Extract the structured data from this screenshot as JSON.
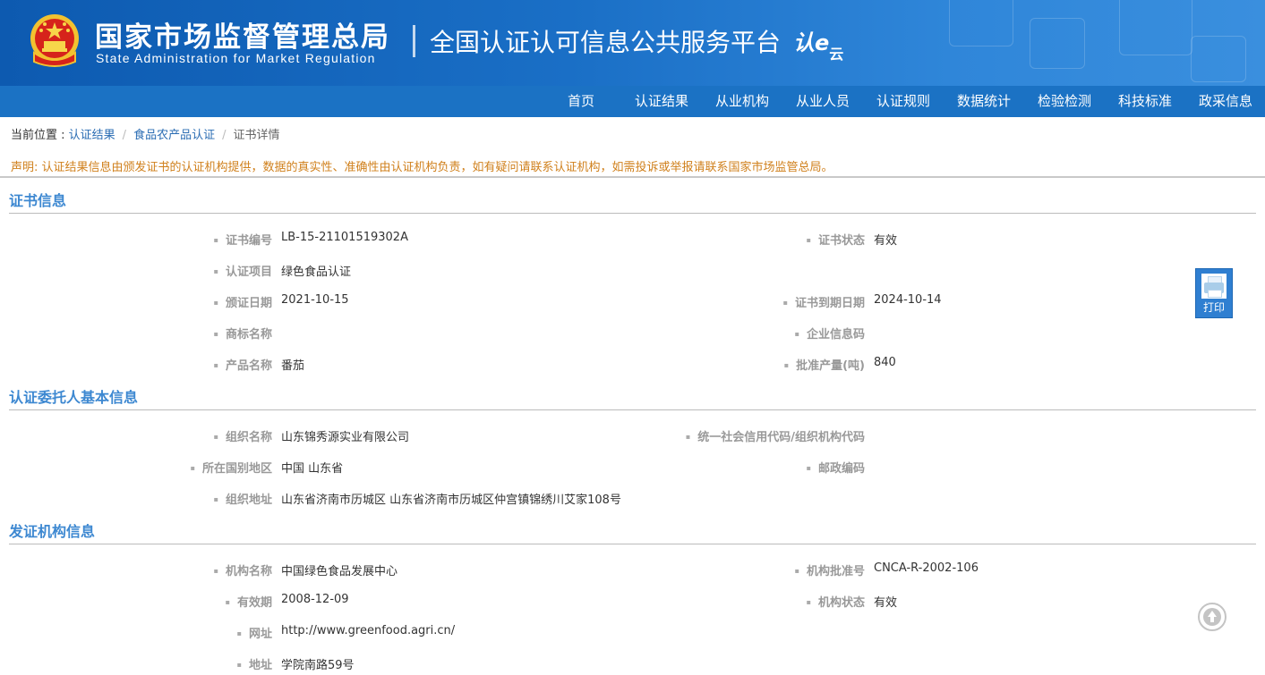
{
  "header": {
    "title_cn": "国家市场监督管理总局",
    "title_en": "State Administration  for  Market Regulation",
    "platform": "全国认证认可信息公共服务平台",
    "logo_text": "认e",
    "logo_sub": "云"
  },
  "nav": {
    "items": [
      {
        "label": "首页"
      },
      {
        "label": "认证结果"
      },
      {
        "label": "从业机构"
      },
      {
        "label": "从业人员"
      },
      {
        "label": "认证规则"
      },
      {
        "label": "数据统计"
      },
      {
        "label": "检验检测"
      },
      {
        "label": "科技标准"
      },
      {
        "label": "政采信息"
      }
    ]
  },
  "breadcrumb": {
    "prefix": "当前位置 : ",
    "items": [
      "认证结果",
      "食品农产品认证"
    ],
    "sep": "/",
    "current": "证书详情"
  },
  "notice": "声明: 认证结果信息由颁发证书的认证机构提供，数据的真实性、准确性由认证机构负责，如有疑问请联系认证机构，如需投诉或举报请联系国家市场监管总局。",
  "sections": {
    "cert": {
      "title": "证书信息",
      "cert_no_label": "证书编号",
      "cert_no": "LB-15-21101519302A",
      "status_label": "证书状态",
      "status": "有效",
      "project_label": "认证项目",
      "project": "绿色食品认证",
      "issue_date_label": "颁证日期",
      "issue_date": "2021-10-15",
      "expire_label": "证书到期日期",
      "expire_date": "2024-10-14",
      "trademark_label": "商标名称",
      "trademark": "",
      "enterprise_code_label": "企业信息码",
      "enterprise_code": "",
      "product_label": "产品名称",
      "product": "番茄",
      "output_label": "批准产量(吨)",
      "output": "840"
    },
    "client": {
      "title": "认证委托人基本信息",
      "org_name_label": "组织名称",
      "org_name": "山东锦秀源实业有限公司",
      "credit_code_label": "统一社会信用代码/组织机构代码",
      "credit_code": "",
      "region_label": "所在国别地区",
      "region": "中国 山东省",
      "postcode_label": "邮政编码",
      "postcode": "",
      "address_label": "组织地址",
      "address": "山东省济南市历城区 山东省济南市历城区仲宫镇锦绣川艾家108号"
    },
    "issuer": {
      "title": "发证机构信息",
      "name_label": "机构名称",
      "name": "中国绿色食品发展中心",
      "approval_label": "机构批准号",
      "approval_no": "CNCA-R-2002-106",
      "validity_label": "有效期",
      "validity": "2008-12-09",
      "status_label": "机构状态",
      "status": "有效",
      "website_label": "网址",
      "website": "http://www.greenfood.agri.cn/",
      "address_label": "地址",
      "address": "学院南路59号"
    }
  },
  "print_label": "打印",
  "colors": {
    "header_blue": "#1b72c4",
    "section_title": "#3d88d1",
    "notice": "#d0801c"
  }
}
